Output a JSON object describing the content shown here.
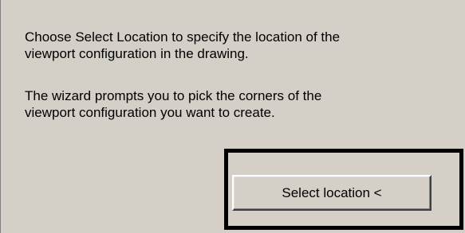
{
  "wizard": {
    "paragraph_1_line_1": "Choose Select Location to specify the location of the",
    "paragraph_1_line_2": "viewport configuration in the drawing.",
    "paragraph_2_line_1": "The wizard prompts you to pick the corners of the",
    "paragraph_2_line_2": "viewport configuration you want to create."
  },
  "select_location_button": {
    "label": "Select location <"
  },
  "colors": {
    "panel_background": "#d4d0c8",
    "highlight_frame": "#000000",
    "text": "#000000"
  }
}
